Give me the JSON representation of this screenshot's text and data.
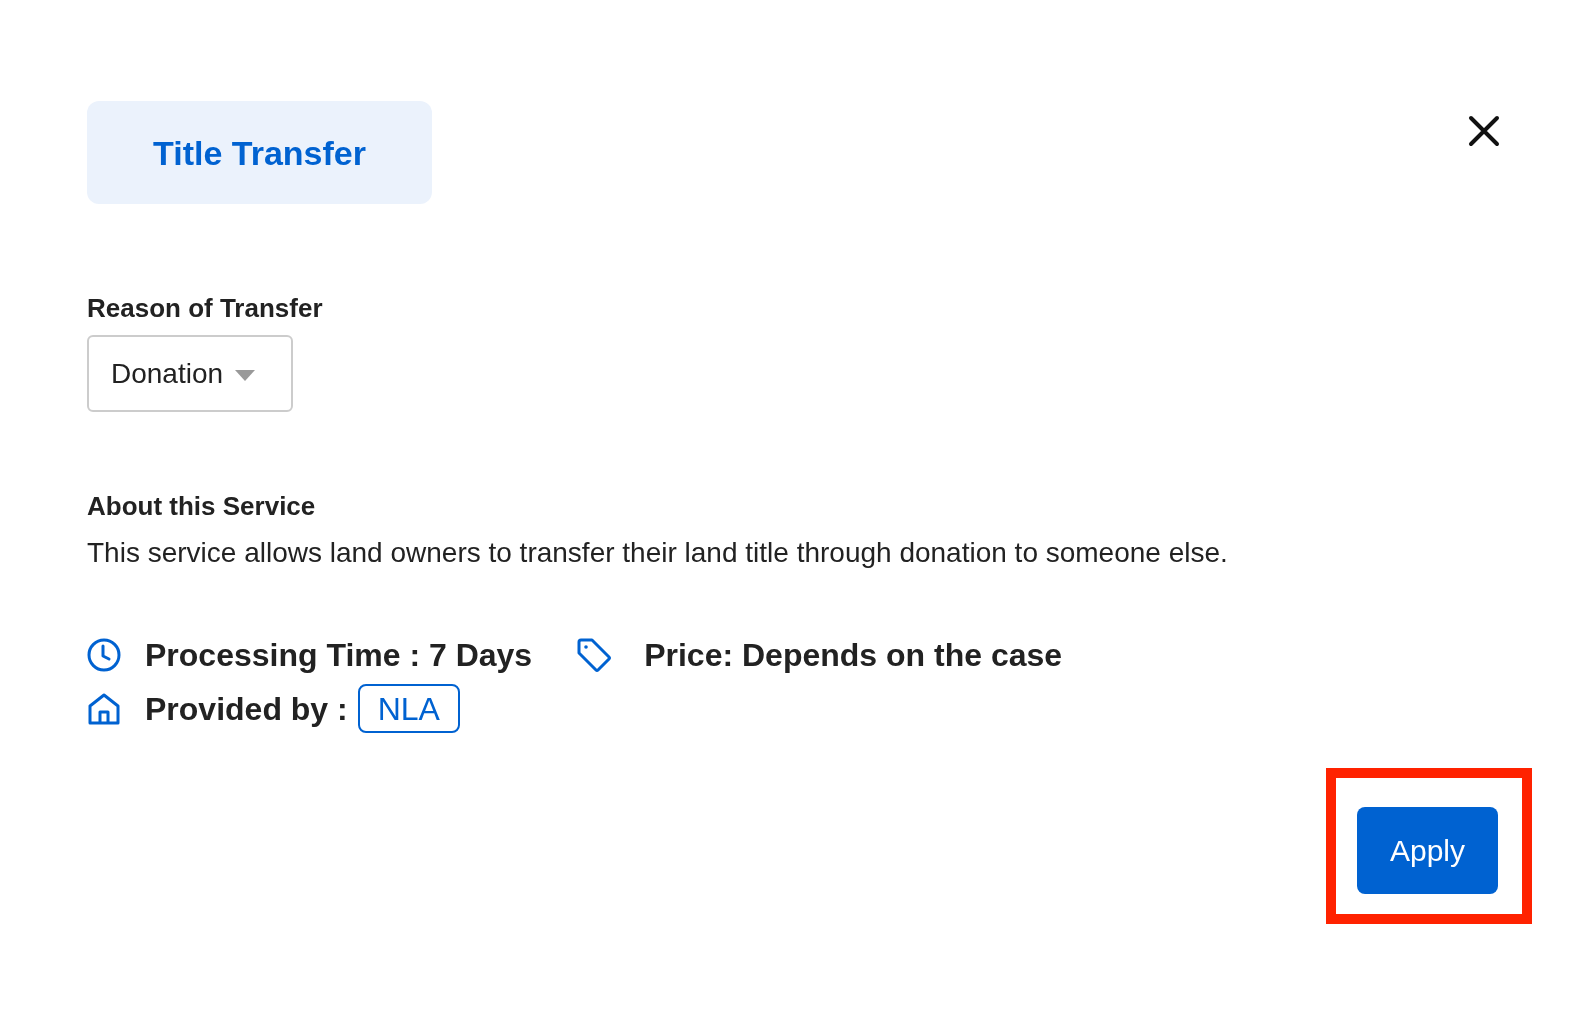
{
  "dialog": {
    "title": "Title Transfer"
  },
  "reason": {
    "label": "Reason of Transfer",
    "value": "Donation"
  },
  "about": {
    "heading": "About this Service",
    "text": "This service allows land owners to transfer their land title through donation to someone else."
  },
  "details": {
    "processing_time": "Processing Time : 7 Days",
    "price": "Price: Depends on the case",
    "provider": {
      "label": "Provided by :",
      "badge": "NLA"
    }
  },
  "actions": [
    {
      "label": "Apply",
      "highlighted": true
    }
  ]
}
